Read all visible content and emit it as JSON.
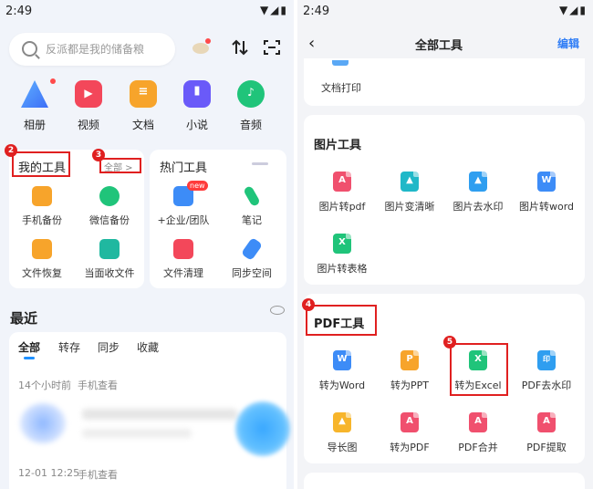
{
  "left": {
    "status": {
      "time": "2:49",
      "icons": "▼◢▮"
    },
    "search": {
      "placeholder": "反派都是我的储备粮"
    },
    "apps": [
      {
        "label": "相册",
        "icon": "album-icon",
        "color": "#3d8cf7"
      },
      {
        "label": "视频",
        "icon": "video-icon",
        "color": "#f3475a"
      },
      {
        "label": "文档",
        "icon": "doc-icon",
        "color": "#f7a42b"
      },
      {
        "label": "小说",
        "icon": "novel-icon",
        "color": "#6a5af9"
      },
      {
        "label": "音频",
        "icon": "music-icon",
        "color": "#20c47a"
      }
    ],
    "my_tools": {
      "title": "我的工具",
      "all_link": "全部 >",
      "badge_title": "2",
      "badge_all": "3",
      "items": [
        {
          "label": "手机备份",
          "color": "#f7a42b"
        },
        {
          "label": "微信备份",
          "color": "#20c47a"
        },
        {
          "label": "文件恢复",
          "color": "#f7a42b"
        },
        {
          "label": "当面收文件",
          "color": "#20b8a0"
        }
      ]
    },
    "hot_tools": {
      "title": "热门工具",
      "new_badge": "new",
      "items": [
        {
          "label": "+企业/团队",
          "color": "#3d8cf7"
        },
        {
          "label": "笔记",
          "color": "#20c47a"
        },
        {
          "label": "文件清理",
          "color": "#f3475a"
        },
        {
          "label": "同步空间",
          "color": "#3d8cf7"
        }
      ]
    },
    "recent": {
      "title": "最近",
      "tabs": [
        "全部",
        "转存",
        "同步",
        "收藏"
      ],
      "entries": [
        {
          "time": "14个小时前",
          "source": "手机查看"
        },
        {
          "time": "12-01 12:25",
          "source": "手机查看"
        }
      ]
    }
  },
  "right": {
    "status": {
      "time": "2:49",
      "icons": "▼◢▮"
    },
    "nav": {
      "back": "‹",
      "title": "全部工具",
      "edit": "编辑"
    },
    "doc_print": "文档打印",
    "image_tools": {
      "title": "图片工具",
      "items": [
        {
          "label": "图片转pdf",
          "color": "#f0506e",
          "glyph": "A"
        },
        {
          "label": "图片变清晰",
          "color": "#20b8c8",
          "glyph": "▲"
        },
        {
          "label": "图片去水印",
          "color": "#2f9ef0",
          "glyph": "▲"
        },
        {
          "label": "图片转word",
          "color": "#3d8cf7",
          "glyph": "W"
        },
        {
          "label": "图片转表格",
          "color": "#20c47a",
          "glyph": "X"
        }
      ]
    },
    "pdf_tools": {
      "title": "PDF工具",
      "badge_title": "4",
      "badge_excel": "5",
      "items": [
        {
          "label": "转为Word",
          "color": "#3d8cf7",
          "glyph": "W"
        },
        {
          "label": "转为PPT",
          "color": "#f7a42b",
          "glyph": "P"
        },
        {
          "label": "转为Excel",
          "color": "#20c47a",
          "glyph": "X"
        },
        {
          "label": "PDF去水印",
          "color": "#2f9ef0",
          "glyph": "印"
        },
        {
          "label": "导长图",
          "color": "#f7b52b",
          "glyph": "▲"
        },
        {
          "label": "转为PDF",
          "color": "#f0506e",
          "glyph": "A"
        },
        {
          "label": "PDF合并",
          "color": "#f0506e",
          "glyph": "A"
        },
        {
          "label": "PDF提取",
          "color": "#f0506e",
          "glyph": "A"
        }
      ]
    }
  }
}
